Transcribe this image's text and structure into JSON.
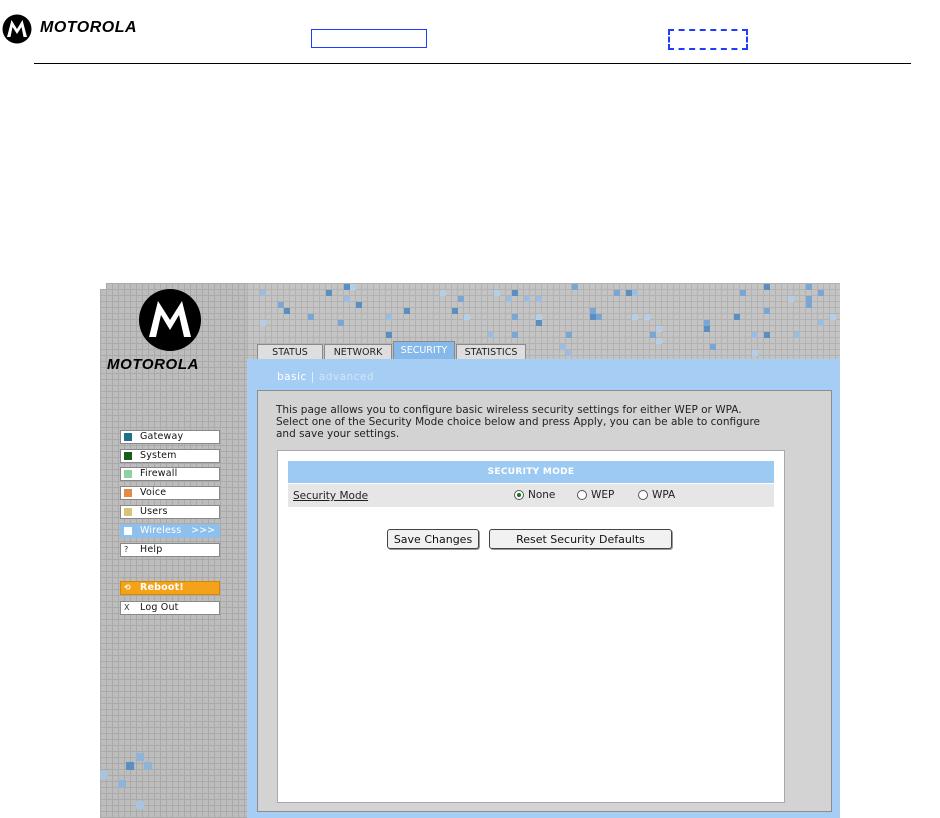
{
  "doc": {
    "brand": "MOTOROLA"
  },
  "ui": {
    "brand": "MOTOROLA",
    "tabs": [
      {
        "label": "STATUS",
        "active": false
      },
      {
        "label": "NETWORK",
        "active": false
      },
      {
        "label": "SECURITY",
        "active": true
      },
      {
        "label": "STATISTICS",
        "active": false
      }
    ],
    "subnav": {
      "basic": "basic",
      "separator": "|",
      "advanced": "advanced"
    },
    "intro_lines": [
      "This page allows you to configure basic wireless security settings for either WEP or WPA.",
      "Select one of the Security Mode choice below and press Apply, you can be able to configure",
      "and save your settings."
    ],
    "section_header": "SECURITY MODE",
    "field_label": "Security Mode",
    "radio_options": [
      {
        "label": "None",
        "selected": true
      },
      {
        "label": "WEP",
        "selected": false
      },
      {
        "label": "WPA",
        "selected": false
      }
    ],
    "buttons": {
      "save": "Save Changes",
      "reset": "Reset Security Defaults"
    },
    "menu": [
      {
        "label": "Gateway",
        "color": "#1e6f8e"
      },
      {
        "label": "System",
        "color": "#1a5c1a"
      },
      {
        "label": "Firewall",
        "color": "#8fd1a3"
      },
      {
        "label": "Voice",
        "color": "#e08a4a"
      },
      {
        "label": "Users",
        "color": "#d9c27a"
      },
      {
        "label": "Wireless",
        "color": "#ffffff",
        "active": true,
        "arrow": ">>>"
      },
      {
        "label": "Help",
        "glyph": "?"
      }
    ],
    "reboot_label": "Reboot!",
    "reboot_glyph": "⟲",
    "logout_label": "Log Out",
    "logout_glyph": "X",
    "colors": {
      "accent_blue": "#a6cdf4",
      "tab_active": "#86b9ea",
      "reboot": "#f5a21b"
    }
  }
}
